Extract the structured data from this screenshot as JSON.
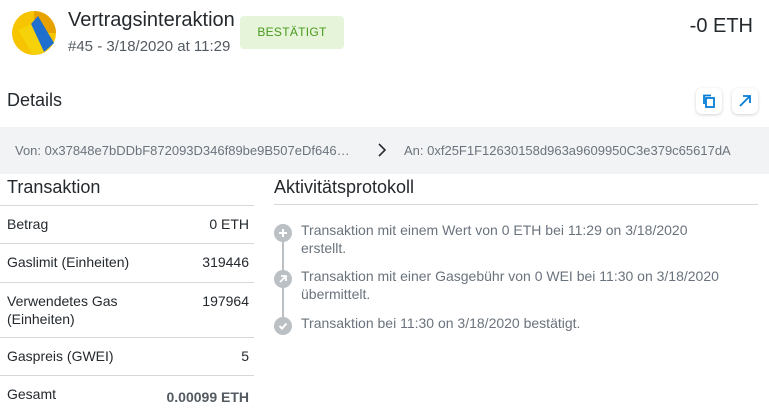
{
  "header": {
    "title": "Vertragsinteraktion",
    "subtitle": "#45 - 3/18/2020 at 11:29",
    "status": "BESTÄTIGT",
    "amount": "-0 ETH"
  },
  "details": {
    "title": "Details",
    "copy_icon": "copy-icon",
    "open_icon": "external-link-icon"
  },
  "addresses": {
    "from": "Von: 0x37848e7bDDbF872093D346f89be9B507eDf646…",
    "to": "An: 0xf25F1F12630158d963a9609950C3e379c65617dA"
  },
  "transaction": {
    "title": "Transaktion",
    "rows": [
      {
        "label": "Betrag",
        "value": "0 ETH"
      },
      {
        "label": "Gaslimit (Einheiten)",
        "value": "319446"
      },
      {
        "label": "Verwendetes Gas (Einheiten)",
        "value": "197964"
      },
      {
        "label": "Gaspreis (GWEI)",
        "value": "5"
      },
      {
        "label": "Gesamt",
        "value": "0.00099 ETH"
      }
    ]
  },
  "activity": {
    "title": "Aktivitätsprotokoll",
    "items": [
      {
        "icon": "plus-icon",
        "text1": "Transaktion mit einem Wert von 0 ETH bei 11:29 on 3/18/2020",
        "text2": "erstellt."
      },
      {
        "icon": "send-arrow-icon",
        "text1": "Transaktion mit einer Gasgebühr von 0 WEI bei 11:30 on 3/18/2020",
        "text2": "übermittelt."
      },
      {
        "icon": "check-icon",
        "text1": "Transaktion bei 11:30 on 3/18/2020 bestätigt.",
        "text2": ""
      }
    ]
  },
  "colors": {
    "badge_bg": "#e6f4d9",
    "badge_text": "#4a9a1f",
    "accent_blue": "#037dd6",
    "muted_text": "#6a737d",
    "address_bar_bg": "#f2f3f4"
  }
}
